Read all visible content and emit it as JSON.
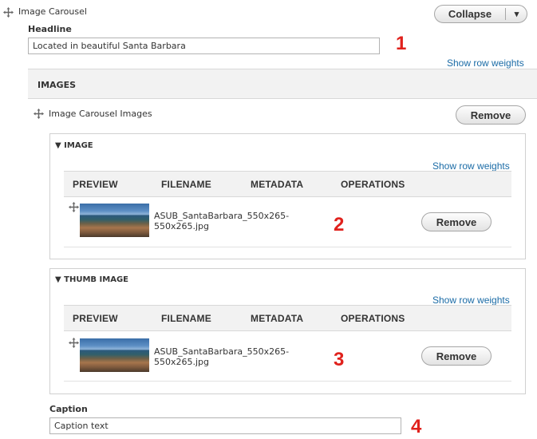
{
  "header": {
    "title": "Image Carousel",
    "collapse_label": "Collapse",
    "dropdown_glyph": "▾"
  },
  "headline": {
    "label": "Headline",
    "value": "Located in beautiful Santa Barbara"
  },
  "show_row_weights": "Show row weights",
  "images_section": {
    "title": "IMAGES",
    "item_title": "Image Carousel Images",
    "remove_label": "Remove"
  },
  "image_group": {
    "title": "▼ IMAGE",
    "show_row_weights": "Show row weights",
    "columns": [
      "PREVIEW",
      "FILENAME",
      "METADATA",
      "OPERATIONS"
    ],
    "rows": [
      {
        "filename": "ASUB_SantaBarbara_550x265-\n550x265.jpg",
        "remove_label": "Remove"
      }
    ]
  },
  "thumb_group": {
    "title": "▼ THUMB IMAGE",
    "show_row_weights": "Show row weights",
    "columns": [
      "PREVIEW",
      "FILENAME",
      "METADATA",
      "OPERATIONS"
    ],
    "rows": [
      {
        "filename": "ASUB_SantaBarbara_550x265-\n550x265.jpg",
        "remove_label": "Remove"
      }
    ]
  },
  "caption": {
    "label": "Caption",
    "value": "Caption text"
  },
  "markers": [
    "1",
    "2",
    "3",
    "4"
  ],
  "icons": {
    "drag": "drag-handle-icon",
    "dropdown": "chevron-down-icon"
  },
  "colors": {
    "link": "#1a6ba6",
    "marker": "#e0211c",
    "section_bg": "#f2f2f2"
  }
}
